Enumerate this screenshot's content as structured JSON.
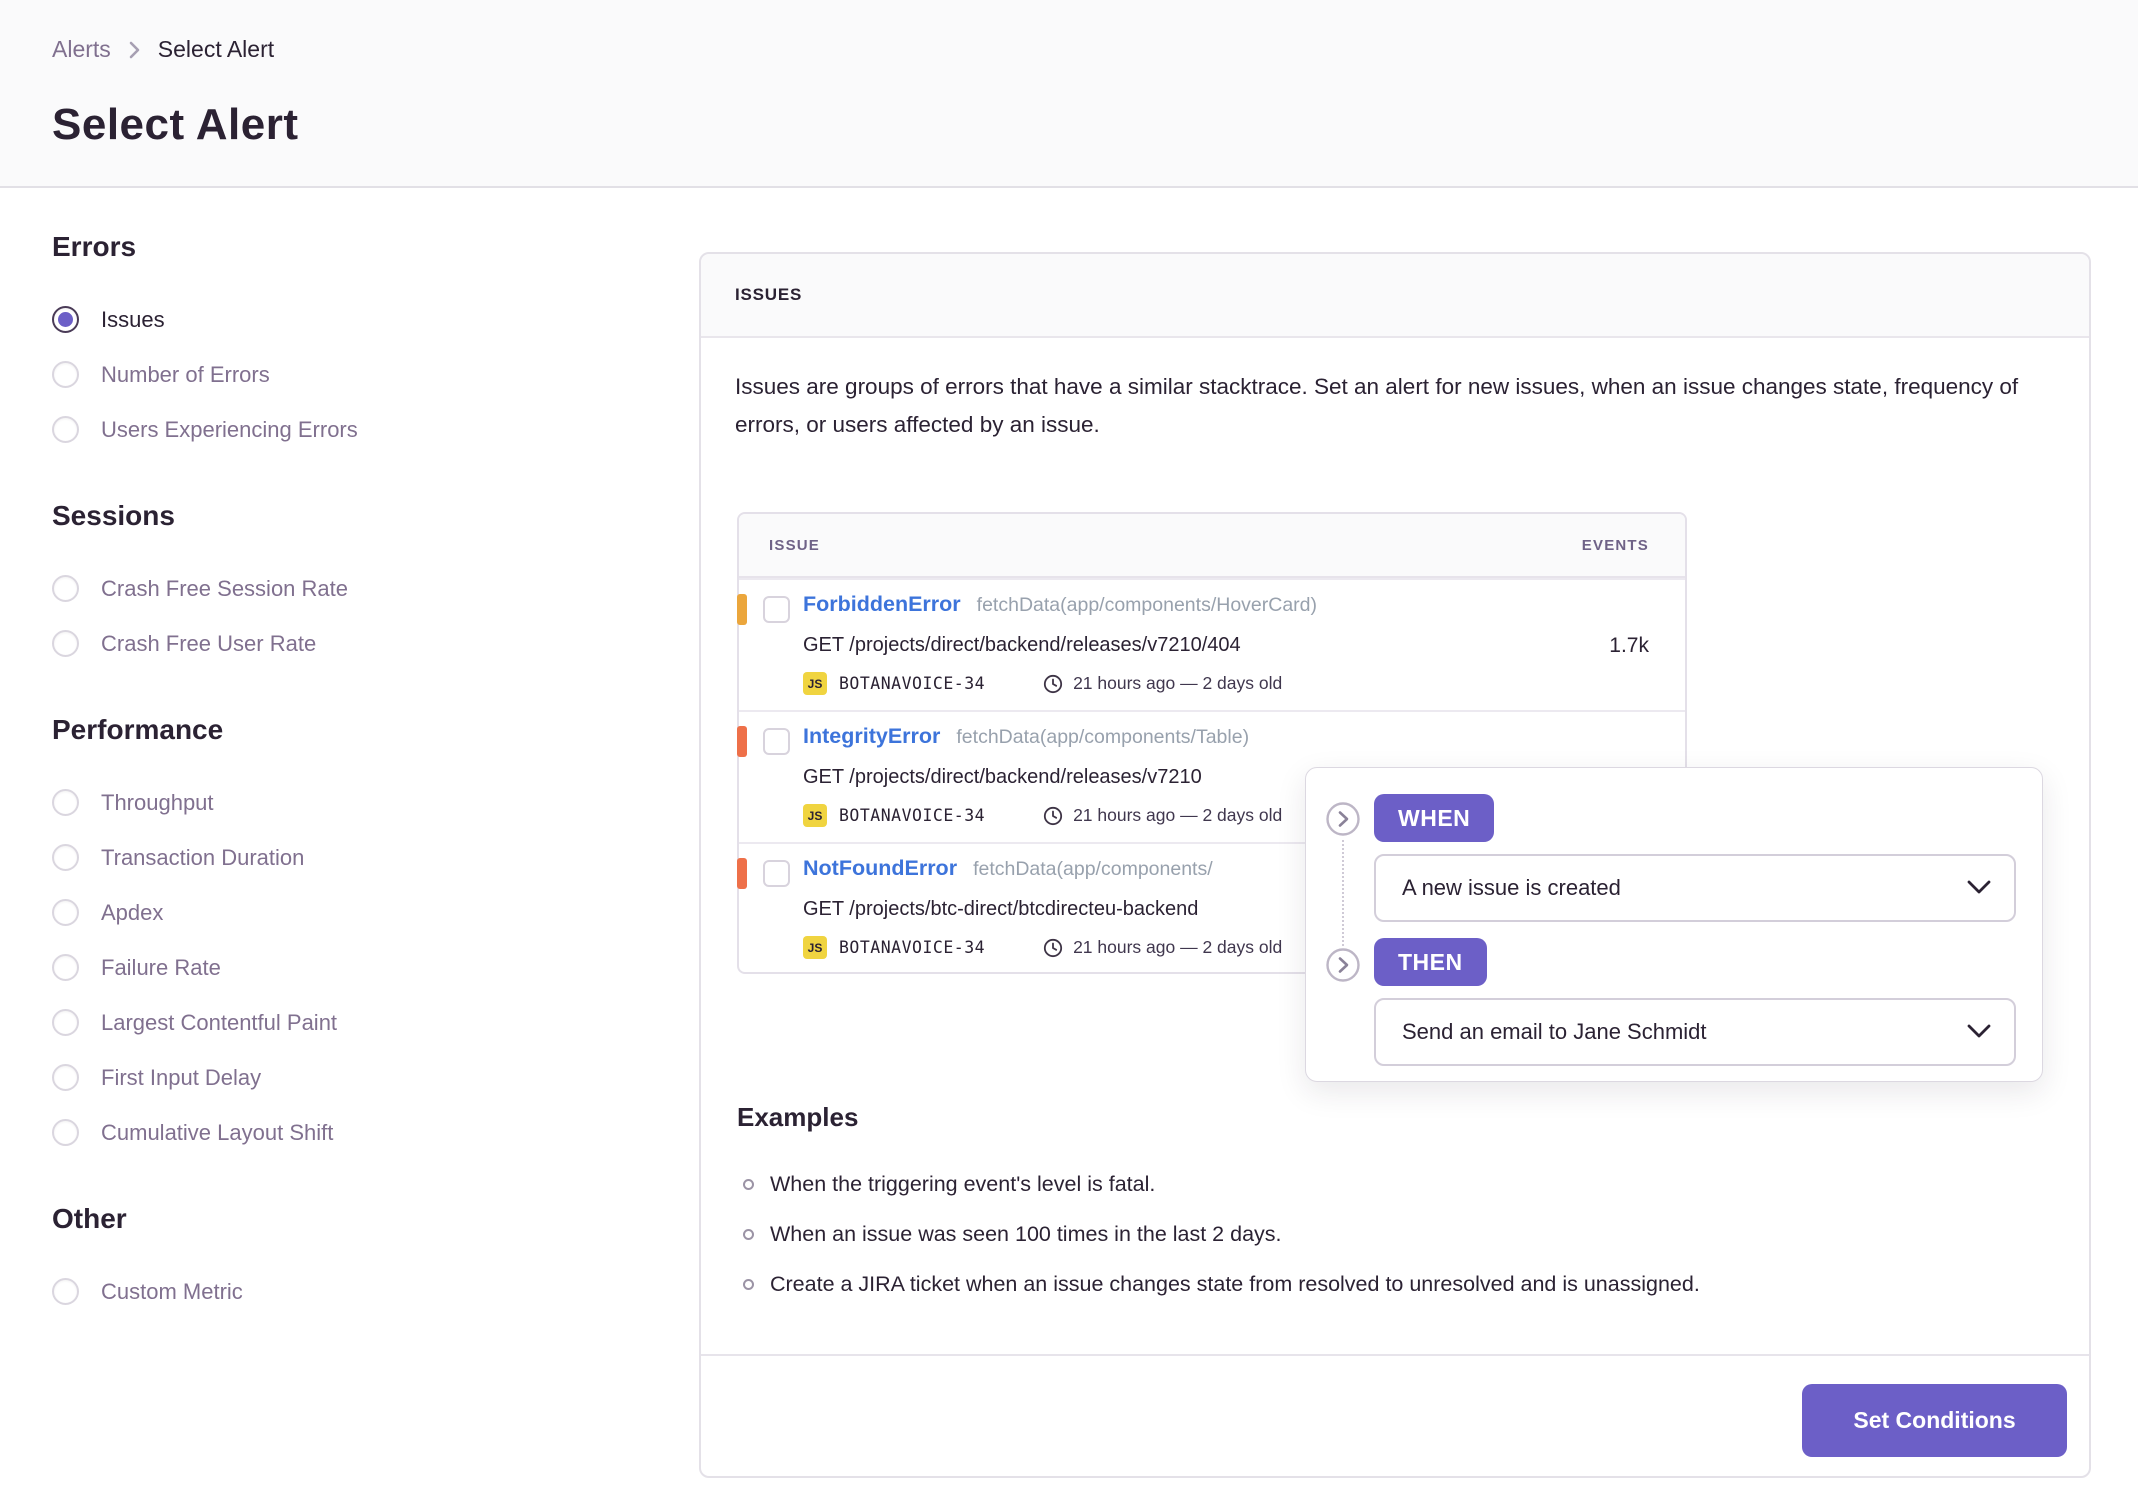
{
  "colors": {
    "accent_purple": "#6C5FC7",
    "link_blue": "#3D74DB",
    "level_warning": "#EBA63C",
    "level_error": "#EE7049",
    "js_badge_yellow": "#F0D440",
    "header_strip_bg": "#FAFAFB"
  },
  "header": {
    "breadcrumb": {
      "root": "Alerts",
      "current": "Select Alert"
    },
    "title": "Select Alert"
  },
  "sidebar": {
    "sections": [
      {
        "heading": "Errors",
        "options": [
          {
            "label": "Issues",
            "selected": true
          },
          {
            "label": "Number of Errors",
            "selected": false
          },
          {
            "label": "Users Experiencing Errors",
            "selected": false
          }
        ]
      },
      {
        "heading": "Sessions",
        "options": [
          {
            "label": "Crash Free Session Rate",
            "selected": false
          },
          {
            "label": "Crash Free User Rate",
            "selected": false
          }
        ]
      },
      {
        "heading": "Performance",
        "options": [
          {
            "label": "Throughput",
            "selected": false
          },
          {
            "label": "Transaction Duration",
            "selected": false
          },
          {
            "label": "Apdex",
            "selected": false
          },
          {
            "label": "Failure Rate",
            "selected": false
          },
          {
            "label": "Largest Contentful Paint",
            "selected": false
          },
          {
            "label": "First Input Delay",
            "selected": false
          },
          {
            "label": "Cumulative Layout Shift",
            "selected": false
          }
        ]
      },
      {
        "heading": "Other",
        "options": [
          {
            "label": "Custom Metric",
            "selected": false
          }
        ]
      }
    ]
  },
  "panel": {
    "header": "ISSUES",
    "description": "Issues are groups of errors that have a similar stacktrace. Set an alert for new issues, when an issue changes state, frequency of errors, or users affected by an issue.",
    "table": {
      "col_issue": "ISSUE",
      "col_events": "EVENTS",
      "rows": [
        {
          "level_color": "#EBA63C",
          "name": "ForbiddenError",
          "culprit": "fetchData(app/components/HoverCard)",
          "query": "GET /projects/direct/backend/releases/v7210/404",
          "project": "BOTANAVOICE-34",
          "time": "21 hours ago — 2 days old",
          "events": "1.7k"
        },
        {
          "level_color": "#EE7049",
          "name": "IntegrityError",
          "culprit": "fetchData(app/components/Table)",
          "query": "GET /projects/direct/backend/releases/v7210",
          "project": "BOTANAVOICE-34",
          "time": "21 hours ago — 2 days old",
          "events": ""
        },
        {
          "level_color": "#EE7049",
          "name": "NotFoundError",
          "culprit": "fetchData(app/components/",
          "query": "GET /projects/btc-direct/btcdirecteu-backend",
          "project": "BOTANAVOICE-34",
          "time": "21 hours ago — 2 days old",
          "events": ""
        }
      ]
    },
    "examples": {
      "heading": "Examples",
      "items": [
        "When the triggering event's level is fatal.",
        "When an issue was seen 100 times in the last 2 days.",
        "Create a JIRA ticket when an issue changes state from resolved to unresolved and is unassigned."
      ]
    },
    "footer": {
      "submit_label": "Set Conditions"
    }
  },
  "rule_popup": {
    "when_label": "WHEN",
    "when_value": "A new issue is created",
    "then_label": "THEN",
    "then_value": "Send an email to Jane Schmidt"
  }
}
